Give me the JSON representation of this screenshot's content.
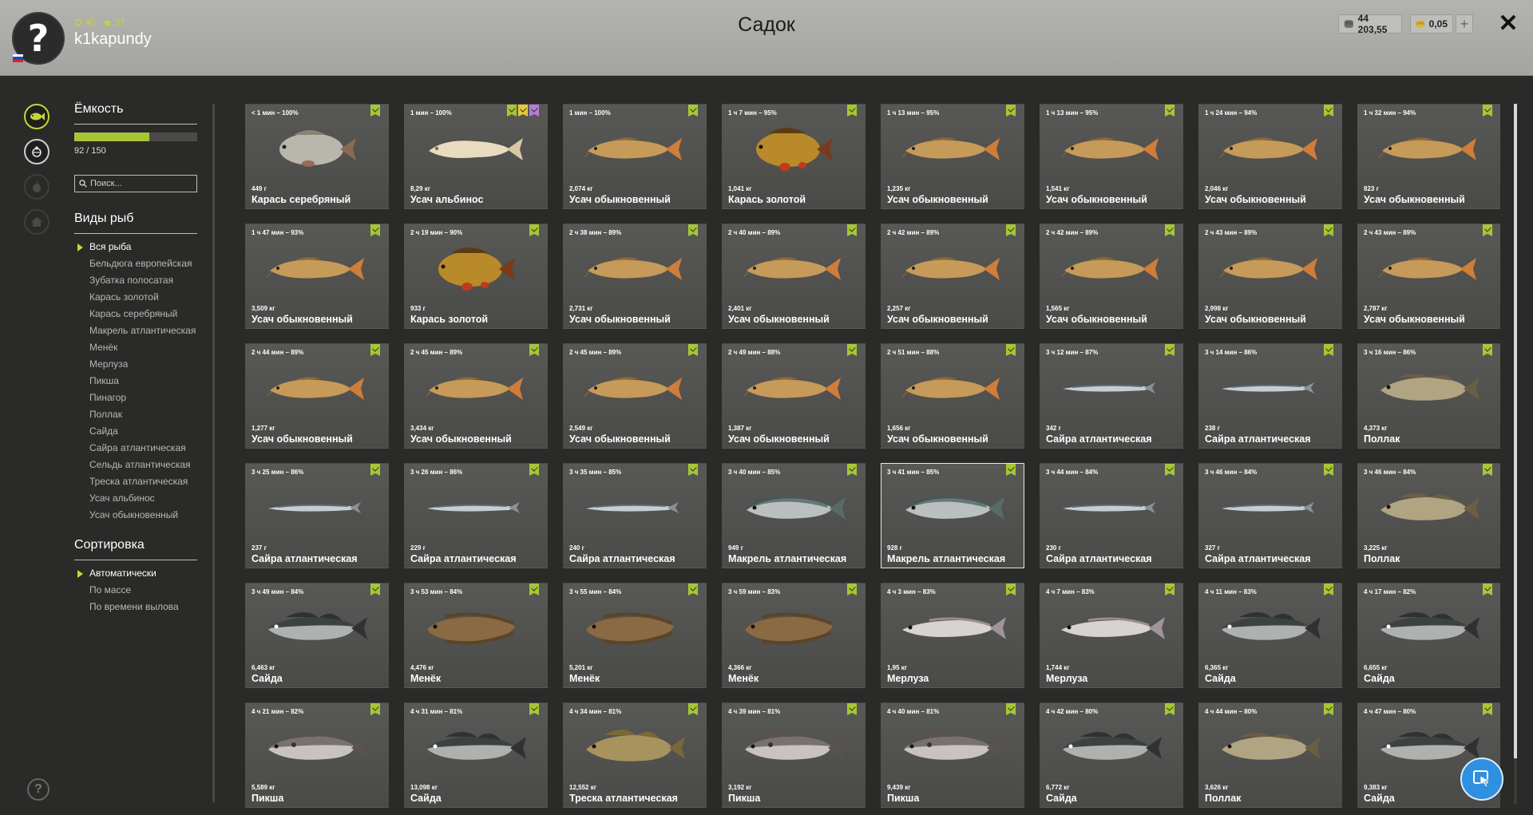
{
  "header": {
    "title": "Садок",
    "player": {
      "name": "k1kapundy",
      "level": "40",
      "rank": "37",
      "avatar_glyph": "?"
    },
    "currency": {
      "silver": "44 203,55",
      "gold": "0,05"
    },
    "plus_glyph": "+",
    "close_glyph": "✕"
  },
  "sidebar": {
    "capacity": {
      "title": "Ёмкость",
      "current": 92,
      "max": 150,
      "text": "92 / 150"
    },
    "search": {
      "placeholder": "Поиск..."
    },
    "types": {
      "title": "Виды рыб",
      "items": [
        "Вся рыба",
        "Бельдюга европейская",
        "Зубатка полосатая",
        "Карась золотой",
        "Карась серебряный",
        "Макрель атлантическая",
        "Менёк",
        "Мерлуза",
        "Пикша",
        "Пинагор",
        "Поллак",
        "Сайда",
        "Сайра атлантическая",
        "Сельдь атлантическая",
        "Треска атлантическая",
        "Усач альбинос",
        "Усач обыкновенный"
      ],
      "selected": 0
    },
    "sort": {
      "title": "Сортировка",
      "items": [
        "Автоматически",
        "По массе",
        "По времени вылова"
      ],
      "selected": 0
    },
    "help_glyph": "?"
  },
  "colors": {
    "accent": "#a6c636",
    "badge": "#a6c636",
    "panel": "#4f4f4d",
    "header": "#acacaa"
  },
  "fish": [
    {
      "time": "< 1 мин – 100%",
      "weight": "449 г",
      "name": "Карась серебряный",
      "kind": "crucian-silver",
      "badges": [
        "check"
      ]
    },
    {
      "time": "1 мин – 100%",
      "weight": "8,29 кг",
      "name": "Усач альбинос",
      "kind": "barbel-albino",
      "badges": [
        "check",
        "star",
        "purple"
      ]
    },
    {
      "time": "1 мин – 100%",
      "weight": "2,074 кг",
      "name": "Усач обыкновенный",
      "kind": "barbel",
      "badges": [
        "check"
      ]
    },
    {
      "time": "1 ч 7 мин – 95%",
      "weight": "1,041 кг",
      "name": "Карась золотой",
      "kind": "crucian-gold",
      "badges": [
        "check"
      ]
    },
    {
      "time": "1 ч 13 мин – 95%",
      "weight": "1,235 кг",
      "name": "Усач обыкновенный",
      "kind": "barbel",
      "badges": [
        "check"
      ]
    },
    {
      "time": "1 ч 13 мин – 95%",
      "weight": "1,541 кг",
      "name": "Усач обыкновенный",
      "kind": "barbel",
      "badges": [
        "check"
      ]
    },
    {
      "time": "1 ч 24 мин – 94%",
      "weight": "2,046 кг",
      "name": "Усач обыкновенный",
      "kind": "barbel",
      "badges": [
        "check"
      ]
    },
    {
      "time": "1 ч 32 мин – 94%",
      "weight": "823 г",
      "name": "Усач обыкновенный",
      "kind": "barbel",
      "badges": [
        "check"
      ]
    },
    {
      "time": "1 ч 47 мин – 93%",
      "weight": "3,509 кг",
      "name": "Усач обыкновенный",
      "kind": "barbel",
      "badges": [
        "check"
      ]
    },
    {
      "time": "2 ч 19 мин – 90%",
      "weight": "933 г",
      "name": "Карась золотой",
      "kind": "crucian-gold",
      "badges": [
        "check"
      ]
    },
    {
      "time": "2 ч 38 мин – 89%",
      "weight": "2,731 кг",
      "name": "Усач обыкновенный",
      "kind": "barbel",
      "badges": [
        "check"
      ]
    },
    {
      "time": "2 ч 40 мин – 89%",
      "weight": "2,401 кг",
      "name": "Усач обыкновенный",
      "kind": "barbel",
      "badges": [
        "check"
      ]
    },
    {
      "time": "2 ч 42 мин – 89%",
      "weight": "2,257 кг",
      "name": "Усач обыкновенный",
      "kind": "barbel",
      "badges": [
        "check"
      ]
    },
    {
      "time": "2 ч 42 мин – 89%",
      "weight": "1,565 кг",
      "name": "Усач обыкновенный",
      "kind": "barbel",
      "badges": [
        "check"
      ]
    },
    {
      "time": "2 ч 43 мин – 89%",
      "weight": "2,998 кг",
      "name": "Усач обыкновенный",
      "kind": "barbel",
      "badges": [
        "check"
      ]
    },
    {
      "time": "2 ч 43 мин – 89%",
      "weight": "2,787 кг",
      "name": "Усач обыкновенный",
      "kind": "barbel",
      "badges": [
        "check"
      ]
    },
    {
      "time": "2 ч 44 мин – 89%",
      "weight": "1,277 кг",
      "name": "Усач обыкновенный",
      "kind": "barbel",
      "badges": [
        "check"
      ]
    },
    {
      "time": "2 ч 45 мин – 89%",
      "weight": "3,434 кг",
      "name": "Усач обыкновенный",
      "kind": "barbel",
      "badges": [
        "check"
      ]
    },
    {
      "time": "2 ч 45 мин – 89%",
      "weight": "2,549 кг",
      "name": "Усач обыкновенный",
      "kind": "barbel",
      "badges": [
        "check"
      ]
    },
    {
      "time": "2 ч 49 мин – 88%",
      "weight": "1,387 кг",
      "name": "Усач обыкновенный",
      "kind": "barbel",
      "badges": [
        "check"
      ]
    },
    {
      "time": "2 ч 51 мин – 88%",
      "weight": "1,656 кг",
      "name": "Усач обыкновенный",
      "kind": "barbel",
      "badges": [
        "check"
      ]
    },
    {
      "time": "3 ч 12 мин – 87%",
      "weight": "342 г",
      "name": "Сайра атлантическая",
      "kind": "saury",
      "badges": [
        "check"
      ]
    },
    {
      "time": "3 ч 14 мин – 86%",
      "weight": "238 г",
      "name": "Сайра атлантическая",
      "kind": "saury",
      "badges": [
        "check"
      ]
    },
    {
      "time": "3 ч 16 мин – 86%",
      "weight": "4,373 кг",
      "name": "Поллак",
      "kind": "pollack",
      "badges": [
        "check"
      ]
    },
    {
      "time": "3 ч 25 мин – 86%",
      "weight": "237 г",
      "name": "Сайра атлантическая",
      "kind": "saury",
      "badges": [
        "check"
      ]
    },
    {
      "time": "3 ч 26 мин – 86%",
      "weight": "229 г",
      "name": "Сайра атлантическая",
      "kind": "saury",
      "badges": [
        "check"
      ]
    },
    {
      "time": "3 ч 35 мин – 85%",
      "weight": "240 г",
      "name": "Сайра атлантическая",
      "kind": "saury",
      "badges": [
        "check"
      ]
    },
    {
      "time": "3 ч 40 мин – 85%",
      "weight": "949 г",
      "name": "Макрель атлантическая",
      "kind": "mackerel",
      "badges": [
        "check"
      ]
    },
    {
      "time": "3 ч 41 мин – 85%",
      "weight": "928 г",
      "name": "Макрель атлантическая",
      "kind": "mackerel",
      "badges": [
        "check"
      ],
      "selected": true
    },
    {
      "time": "3 ч 44 мин – 84%",
      "weight": "230 г",
      "name": "Сайра атлантическая",
      "kind": "saury",
      "badges": [
        "check"
      ]
    },
    {
      "time": "3 ч 46 мин – 84%",
      "weight": "327 г",
      "name": "Сайра атлантическая",
      "kind": "saury",
      "badges": [
        "check"
      ]
    },
    {
      "time": "3 ч 46 мин – 84%",
      "weight": "3,225 кг",
      "name": "Поллак",
      "kind": "pollack",
      "badges": [
        "check"
      ]
    },
    {
      "time": "3 ч 49 мин – 84%",
      "weight": "6,463 кг",
      "name": "Сайда",
      "kind": "saithe",
      "badges": [
        "check"
      ]
    },
    {
      "time": "3 ч 53 мин – 84%",
      "weight": "4,476 кг",
      "name": "Менёк",
      "kind": "tusk",
      "badges": [
        "check"
      ]
    },
    {
      "time": "3 ч 55 мин – 84%",
      "weight": "5,201 кг",
      "name": "Менёк",
      "kind": "tusk",
      "badges": [
        "check"
      ]
    },
    {
      "time": "3 ч 59 мин – 83%",
      "weight": "4,366 кг",
      "name": "Менёк",
      "kind": "tusk",
      "badges": [
        "check"
      ]
    },
    {
      "time": "4 ч 3 мин – 83%",
      "weight": "1,95 кг",
      "name": "Мерлуза",
      "kind": "hake",
      "badges": [
        "check"
      ]
    },
    {
      "time": "4 ч 7 мин – 83%",
      "weight": "1,744 кг",
      "name": "Мерлуза",
      "kind": "hake",
      "badges": [
        "check"
      ]
    },
    {
      "time": "4 ч 11 мин – 83%",
      "weight": "6,365 кг",
      "name": "Сайда",
      "kind": "saithe",
      "badges": [
        "check"
      ]
    },
    {
      "time": "4 ч 17 мин – 82%",
      "weight": "6,655 кг",
      "name": "Сайда",
      "kind": "saithe",
      "badges": [
        "check"
      ]
    },
    {
      "time": "4 ч 21 мин – 82%",
      "weight": "5,589 кг",
      "name": "Пикша",
      "kind": "haddock",
      "badges": [
        "check"
      ]
    },
    {
      "time": "4 ч 31 мин – 81%",
      "weight": "13,098 кг",
      "name": "Сайда",
      "kind": "saithe",
      "badges": [
        "check"
      ]
    },
    {
      "time": "4 ч 34 мин – 81%",
      "weight": "12,552 кг",
      "name": "Треска атлантическая",
      "kind": "cod",
      "badges": [
        "check"
      ]
    },
    {
      "time": "4 ч 39 мин – 81%",
      "weight": "3,192 кг",
      "name": "Пикша",
      "kind": "haddock",
      "badges": [
        "check"
      ]
    },
    {
      "time": "4 ч 40 мин – 81%",
      "weight": "9,439 кг",
      "name": "Пикша",
      "kind": "haddock",
      "badges": [
        "check"
      ]
    },
    {
      "time": "4 ч 42 мин – 80%",
      "weight": "6,772 кг",
      "name": "Сайда",
      "kind": "saithe",
      "badges": [
        "check"
      ]
    },
    {
      "time": "4 ч 44 мин – 80%",
      "weight": "3,626 кг",
      "name": "Поллак",
      "kind": "pollack",
      "badges": [
        "check"
      ]
    },
    {
      "time": "4 ч 47 мин – 80%",
      "weight": "9,383 кг",
      "name": "Сайда",
      "kind": "saithe",
      "badges": [
        "check"
      ]
    }
  ]
}
